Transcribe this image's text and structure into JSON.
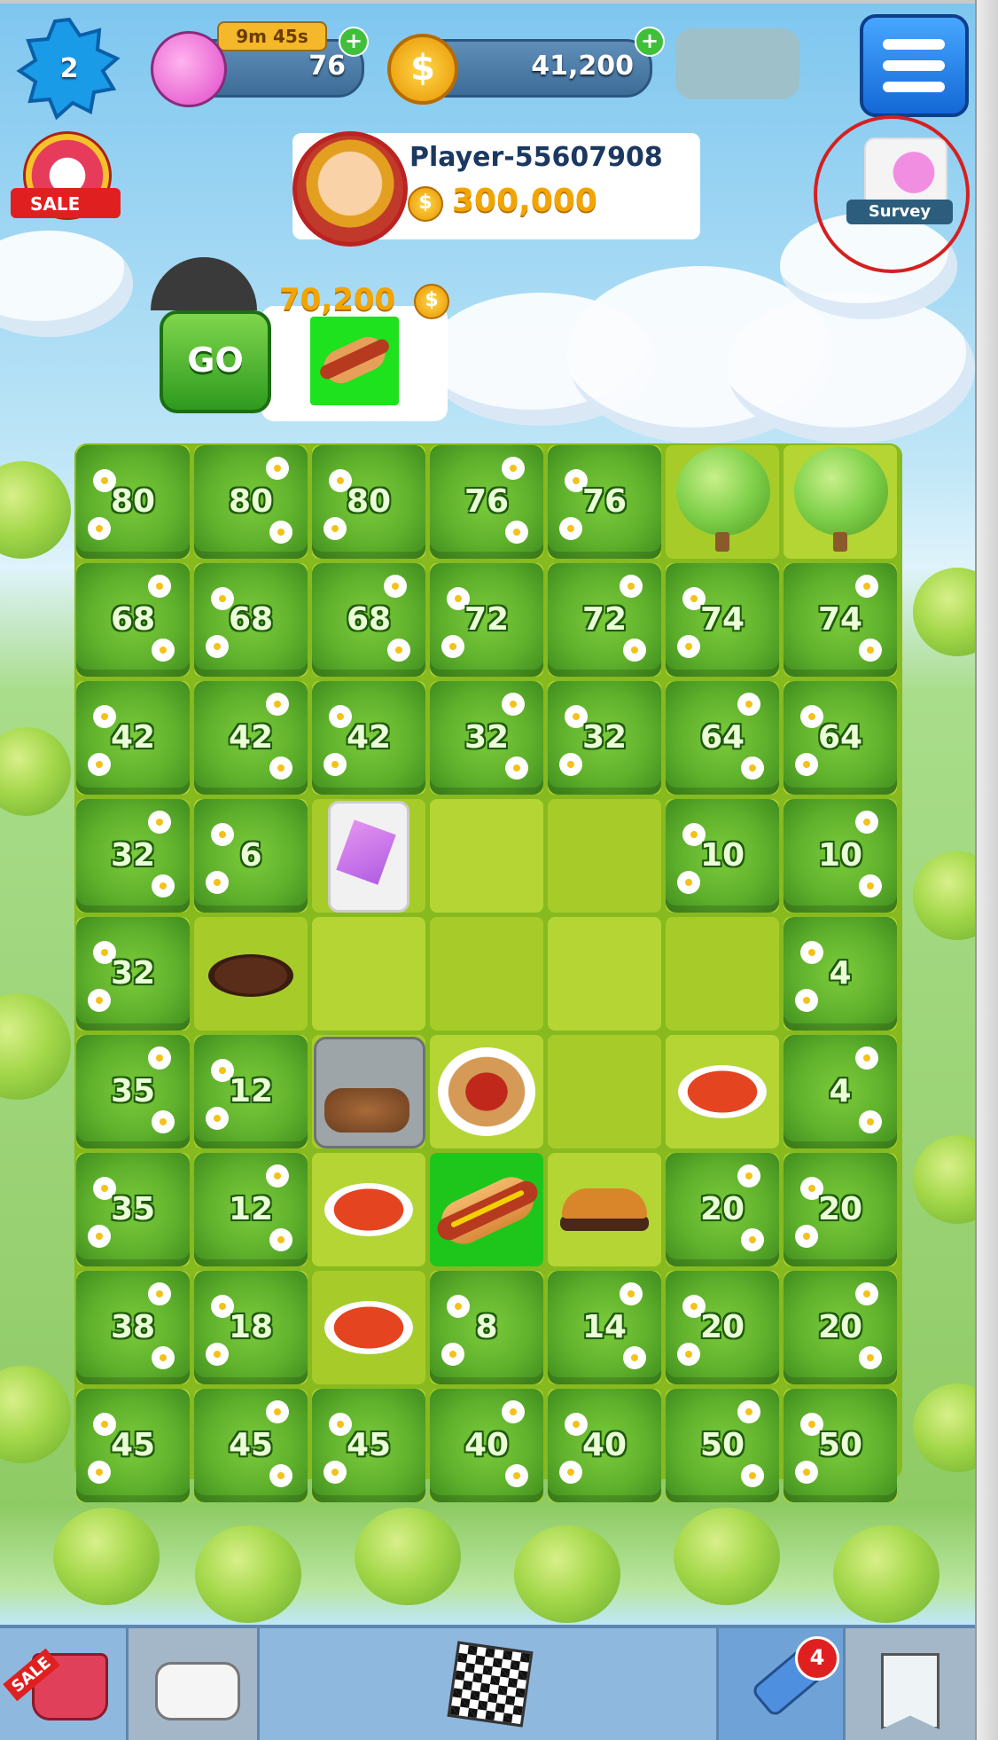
{
  "hud": {
    "level": "2",
    "energy_timer": "9m 45s",
    "energy": "76",
    "coins": "41,200",
    "plus": "+"
  },
  "badges": {
    "sale": "SALE",
    "survey": "Survey"
  },
  "profile": {
    "name": "Player-55607908",
    "coins": "300,000",
    "coin_symbol": "$"
  },
  "order": {
    "reward": "70,200",
    "go": "GO",
    "item_icon": "hotdog-icon"
  },
  "board": {
    "rows": [
      [
        {
          "t": "bush",
          "n": "80"
        },
        {
          "t": "bush",
          "n": "80"
        },
        {
          "t": "bush",
          "n": "80"
        },
        {
          "t": "bush",
          "n": "76"
        },
        {
          "t": "bush",
          "n": "76"
        },
        {
          "t": "tree"
        },
        {
          "t": "tree"
        }
      ],
      [
        {
          "t": "bush",
          "n": "68"
        },
        {
          "t": "bush",
          "n": "68"
        },
        {
          "t": "bush",
          "n": "68"
        },
        {
          "t": "bush",
          "n": "72"
        },
        {
          "t": "bush",
          "n": "72"
        },
        {
          "t": "bush",
          "n": "74"
        },
        {
          "t": "bush",
          "n": "74"
        }
      ],
      [
        {
          "t": "bush",
          "n": "42"
        },
        {
          "t": "bush",
          "n": "42"
        },
        {
          "t": "bush",
          "n": "42"
        },
        {
          "t": "bush",
          "n": "32"
        },
        {
          "t": "bush",
          "n": "32"
        },
        {
          "t": "bush",
          "n": "64"
        },
        {
          "t": "bush",
          "n": "64"
        }
      ],
      [
        {
          "t": "bush",
          "n": "32"
        },
        {
          "t": "bush",
          "n": "6"
        },
        {
          "t": "fridge"
        },
        {
          "t": "empty"
        },
        {
          "t": "empty"
        },
        {
          "t": "bush",
          "n": "10"
        },
        {
          "t": "bush",
          "n": "10"
        }
      ],
      [
        {
          "t": "bush",
          "n": "32"
        },
        {
          "t": "cookie"
        },
        {
          "t": "empty"
        },
        {
          "t": "empty"
        },
        {
          "t": "empty"
        },
        {
          "t": "empty"
        },
        {
          "t": "bush",
          "n": "4"
        }
      ],
      [
        {
          "t": "bush",
          "n": "35"
        },
        {
          "t": "bush",
          "n": "12"
        },
        {
          "t": "crate"
        },
        {
          "t": "spaghetti"
        },
        {
          "t": "empty"
        },
        {
          "t": "soup"
        },
        {
          "t": "bush",
          "n": "4"
        }
      ],
      [
        {
          "t": "bush",
          "n": "35"
        },
        {
          "t": "bush",
          "n": "12"
        },
        {
          "t": "soup"
        },
        {
          "t": "hotdog"
        },
        {
          "t": "burger"
        },
        {
          "t": "bush",
          "n": "20"
        },
        {
          "t": "bush",
          "n": "20"
        }
      ],
      [
        {
          "t": "bush",
          "n": "38"
        },
        {
          "t": "bush",
          "n": "18"
        },
        {
          "t": "soup"
        },
        {
          "t": "bush",
          "n": "8"
        },
        {
          "t": "bush",
          "n": "14"
        },
        {
          "t": "bush",
          "n": "20"
        },
        {
          "t": "bush",
          "n": "20"
        }
      ],
      [
        {
          "t": "bush",
          "n": "45"
        },
        {
          "t": "bush",
          "n": "45"
        },
        {
          "t": "bush",
          "n": "45"
        },
        {
          "t": "bush",
          "n": "40"
        },
        {
          "t": "bush",
          "n": "40"
        },
        {
          "t": "bush",
          "n": "50"
        },
        {
          "t": "bush",
          "n": "50"
        }
      ]
    ]
  },
  "bottom_bar": {
    "shop_label": "SALE",
    "boosters_count": "4",
    "icons": [
      "shop-basket-icon",
      "album-icon",
      "race-flag-icon",
      "hammer-booster-icon",
      "banner-icon"
    ]
  }
}
